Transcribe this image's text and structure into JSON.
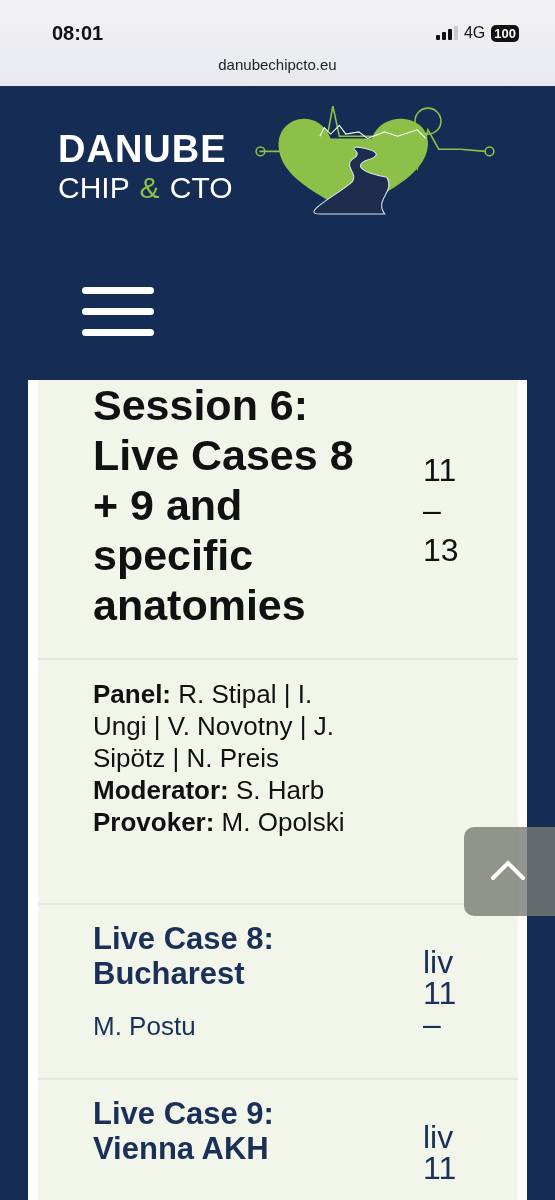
{
  "status_bar": {
    "time": "08:01",
    "network": "4G",
    "battery": "100"
  },
  "address_bar": {
    "url": "danubechipcto.eu"
  },
  "header": {
    "logo_title": "DANUBE",
    "logo_subtitle": [
      {
        "text": "CHIP",
        "accent": false
      },
      {
        "text": "&",
        "accent": true
      },
      {
        "text": "CTO",
        "accent": false
      }
    ]
  },
  "schedule": [
    {
      "kind": "session",
      "title": "Session 6: Live Cases 8 + 9 and specific anatomies",
      "time": "11 – 13"
    },
    {
      "kind": "panel",
      "lines": [
        "**Panel:** R. Stipal | I. Ungi | V. Novotny | J. Sipötz | N. Preis",
        "**Moderator:** S. Harb  **Provoker:** M. Opolski"
      ]
    },
    {
      "kind": "talk",
      "title": "Live Case 8: Bucharest",
      "speaker": "M. Postu",
      "time": "liv 11 –"
    },
    {
      "kind": "talk",
      "title": "Live Case 9: Vienna AKH",
      "time": "liv 11"
    }
  ]
}
